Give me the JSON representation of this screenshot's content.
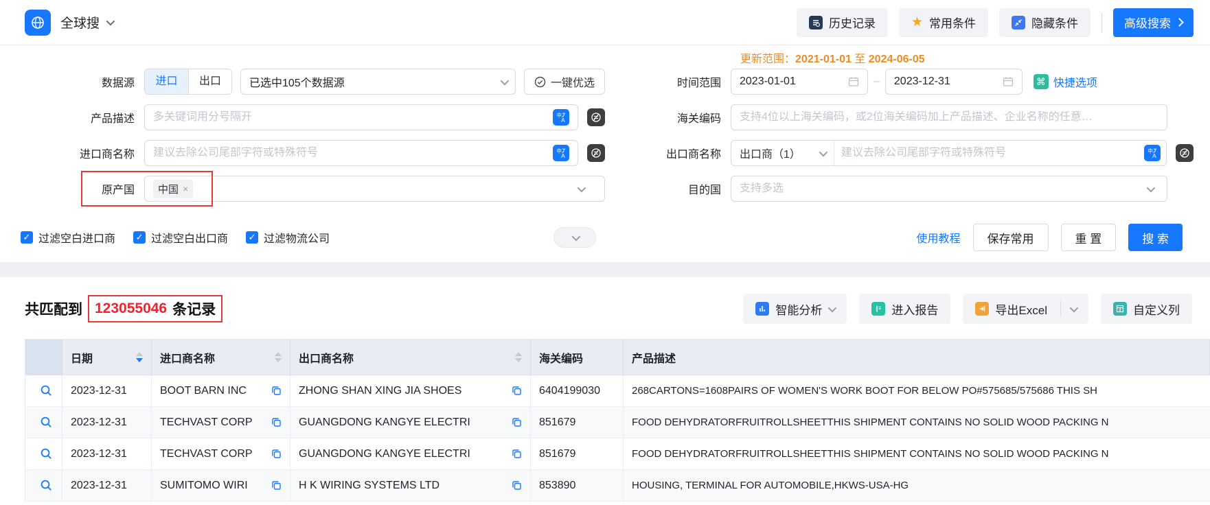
{
  "brand": {
    "title": "全球搜"
  },
  "topbar": {
    "history": "历史记录",
    "favorites": "常用条件",
    "hide": "隐藏条件",
    "advanced": "高级搜索"
  },
  "form": {
    "data_source": {
      "label": "数据源",
      "import_tab": "进口",
      "export_tab": "出口",
      "selected_text": "已选中105个数据源",
      "optimize": "一键优选"
    },
    "update_range": {
      "label": "更新范围：",
      "start": "2021-01-01",
      "to": "至",
      "end": "2024-06-05"
    },
    "time_range": {
      "label": "时间范围",
      "start": "2023-01-01",
      "end": "2023-12-31",
      "quick": "快捷选项"
    },
    "product": {
      "label": "产品描述",
      "placeholder": "多关键词用分号隔开"
    },
    "hs": {
      "label": "海关编码",
      "placeholder": "支持4位以上海关编码，或2位海关编码加上产品描述、企业名称的任意…"
    },
    "importer": {
      "label": "进口商名称",
      "placeholder": "建议去除公司尾部字符或特殊符号"
    },
    "exporter": {
      "label": "出口商名称",
      "selected": "出口商（1）",
      "placeholder": "建议去除公司尾部字符或特殊符号"
    },
    "origin": {
      "label": "原产国",
      "tag": "中国",
      "remove": "×"
    },
    "destination": {
      "label": "目的国",
      "placeholder": "支持多选"
    },
    "filters": [
      {
        "label": "过滤空白进口商",
        "checked": true
      },
      {
        "label": "过滤空白出口商",
        "checked": true
      },
      {
        "label": "过滤物流公司",
        "checked": true
      }
    ],
    "actions": {
      "tutorial": "使用教程",
      "save": "保存常用",
      "reset": "重 置",
      "search": "搜 索"
    }
  },
  "results": {
    "match_prefix": "共匹配到",
    "count": "123055046",
    "match_suffix": "条记录",
    "toolbar": {
      "analysis": "智能分析",
      "report": "进入报告",
      "export": "导出Excel",
      "columns": "自定义列"
    },
    "table": {
      "headers": {
        "date": "日期",
        "importer": "进口商名称",
        "exporter": "出口商名称",
        "hs": "海关编码",
        "desc": "产品描述"
      },
      "rows": [
        {
          "date": "2023-12-31",
          "importer": "BOOT BARN INC",
          "exporter": "ZHONG SHAN XING JIA SHOES",
          "hs": "6404199030",
          "desc": "268CARTONS=1608PAIRS OF WOMEN'S WORK BOOT FOR BELOW PO#575685/575686 THIS SH"
        },
        {
          "date": "2023-12-31",
          "importer": "TECHVAST CORP",
          "exporter": "GUANGDONG KANGYE ELECTRI",
          "hs": "851679",
          "desc": "FOOD DEHYDRATORFRUITROLLSHEETTHIS SHIPMENT CONTAINS NO SOLID WOOD PACKING N"
        },
        {
          "date": "2023-12-31",
          "importer": "TECHVAST CORP",
          "exporter": "GUANGDONG KANGYE ELECTRI",
          "hs": "851679",
          "desc": "FOOD DEHYDRATORFRUITROLLSHEETTHIS SHIPMENT CONTAINS NO SOLID WOOD PACKING N"
        },
        {
          "date": "2023-12-31",
          "importer": "SUMITOMO WIRI",
          "exporter": "H K WIRING SYSTEMS LTD",
          "hs": "853890",
          "desc": "HOUSING, TERMINAL FOR AUTOMOBILE,HKWS-USA-HG"
        }
      ]
    }
  },
  "colors": {
    "primary": "#1678ff",
    "orange": "#ef8b1e",
    "red_box": "#e23a3a",
    "count_red": "#f5222d"
  }
}
